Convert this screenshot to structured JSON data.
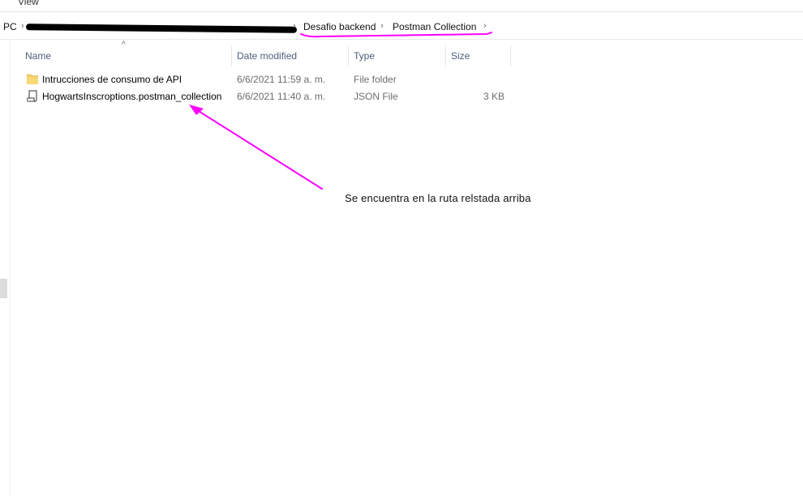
{
  "menu": {
    "view_label": "View"
  },
  "address_bar": {
    "root_label": "PC",
    "crumbs": [
      "Desafio backend",
      "Postman Collection"
    ]
  },
  "columns": {
    "name": "Name",
    "date_modified": "Date modified",
    "type": "Type",
    "size": "Size"
  },
  "files": [
    {
      "name": "Intrucciones de consumo de API",
      "date": "6/6/2021 11:59 a. m.",
      "type": "File folder",
      "size": "",
      "icon": "folder-icon"
    },
    {
      "name": "HogwartsInscroptions.postman_collection",
      "date": "6/6/2021 11:40 a. m.",
      "type": "JSON File",
      "size": "3 KB",
      "icon": "json-file-icon"
    }
  ],
  "annotation": {
    "text": "Se encuentra en la ruta relstada arriba",
    "color": "#ff00ff"
  }
}
